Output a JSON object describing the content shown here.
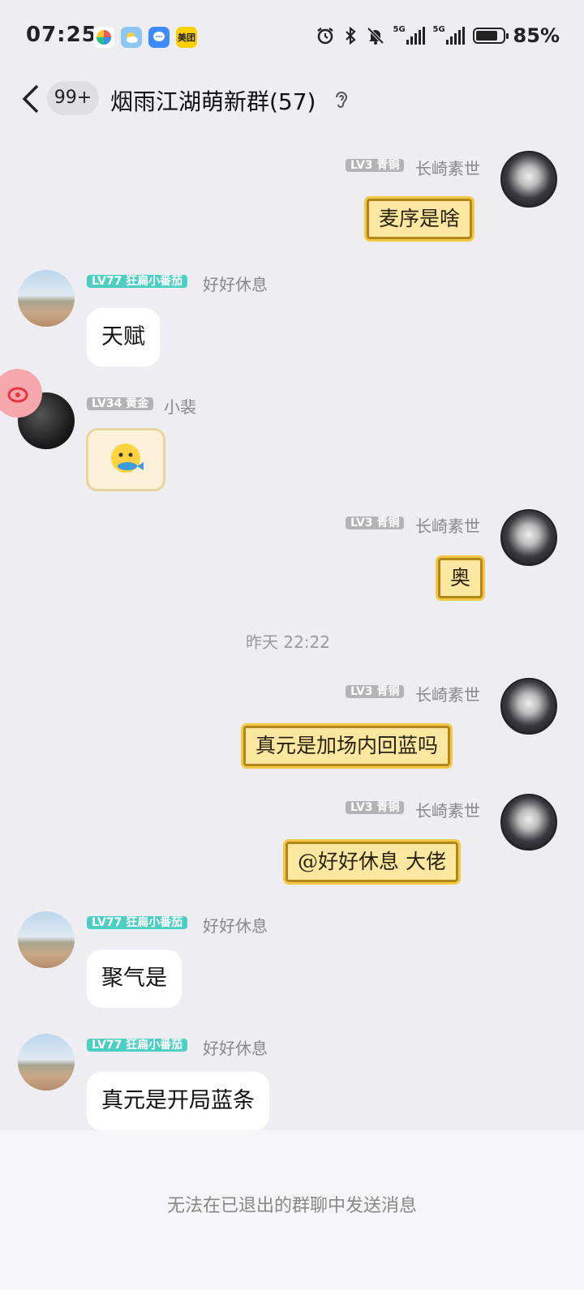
{
  "status": {
    "time": "07:25",
    "battery": "85%",
    "battery_level": 0.85,
    "app_icons": [
      "pinwheel-icon",
      "weather-icon",
      "chat-icon",
      "meituan-icon"
    ],
    "meituan_label": "美团",
    "network": [
      "5G",
      "5G"
    ]
  },
  "header": {
    "unread": "99+",
    "title": "烟雨江湖萌新群(57)"
  },
  "messages": [
    {
      "side": "right",
      "badge": "LV3 青铜",
      "name": "长崎素世",
      "text": "麦序是啥",
      "style": "gold"
    },
    {
      "side": "left",
      "badge": "LV77 狂扁小番茄",
      "name": "好好休息",
      "text": "天赋",
      "style": "plain"
    },
    {
      "side": "left",
      "badge": "LV34 黄金",
      "name": "小裴",
      "text": "",
      "style": "sticker"
    },
    {
      "side": "right",
      "badge": "LV3 青铜",
      "name": "长崎素世",
      "text": "奥",
      "style": "gold"
    },
    {
      "side": "right",
      "badge": "LV3 青铜",
      "name": "长崎素世",
      "text": "真元是加场内回蓝吗",
      "style": "gold"
    },
    {
      "side": "right",
      "badge": "LV3 青铜",
      "name": "长崎素世",
      "text": "@好好休息 大佬",
      "style": "gold"
    },
    {
      "side": "left",
      "badge": "LV77 狂扁小番茄",
      "name": "好好休息",
      "text": "聚气是",
      "style": "plain"
    },
    {
      "side": "left",
      "badge": "LV77 狂扁小番茄",
      "name": "好好休息",
      "text": "真元是开局蓝条",
      "style": "plain"
    }
  ],
  "timestamp": "昨天 22:22",
  "footer": {
    "notice": "无法在已退出的群聊中发送消息"
  },
  "colors": {
    "background": "#eeeef2",
    "teal_badge": "#4ccfc2",
    "gray_badge": "#b3b3b8",
    "gold_bubble": "#fbe7a0"
  }
}
